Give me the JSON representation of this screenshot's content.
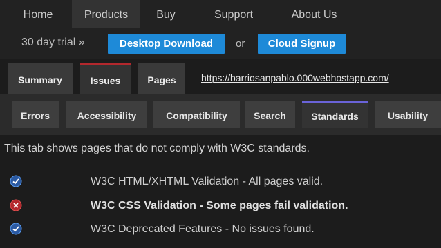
{
  "nav": {
    "items": [
      {
        "label": "Home"
      },
      {
        "label": "Products"
      },
      {
        "label": "Buy"
      },
      {
        "label": "Support"
      },
      {
        "label": "About Us"
      }
    ]
  },
  "trial": {
    "text": "30 day trial »",
    "desktop_button": "Desktop Download",
    "or": "or",
    "cloud_button": "Cloud Signup",
    "button_color": "#1e8ad8"
  },
  "main_tabs": {
    "items": [
      {
        "label": "Summary"
      },
      {
        "label": "Issues"
      },
      {
        "label": "Pages"
      }
    ],
    "url": "https://barriosanpablo.000webhostapp.com/",
    "active_color": "#b3282d"
  },
  "sub_tabs": {
    "items": [
      {
        "label": "Errors"
      },
      {
        "label": "Accessibility"
      },
      {
        "label": "Compatibility"
      },
      {
        "label": "Search"
      },
      {
        "label": "Standards"
      },
      {
        "label": "Usability"
      }
    ],
    "active_color": "#6a63d8"
  },
  "content": {
    "description": "This tab shows pages that do not comply with W3C standards.",
    "results": [
      {
        "icon": "check-circle-icon",
        "status": "pass",
        "text": "W3C HTML/XHTML Validation - All pages valid."
      },
      {
        "icon": "error-circle-icon",
        "status": "fail",
        "text": "W3C CSS Validation - Some pages fail validation."
      },
      {
        "icon": "check-circle-icon",
        "status": "pass",
        "text": "W3C Deprecated Features - No issues found."
      }
    ],
    "pass_color": "#3b7fd4",
    "fail_color": "#d23a3a"
  }
}
